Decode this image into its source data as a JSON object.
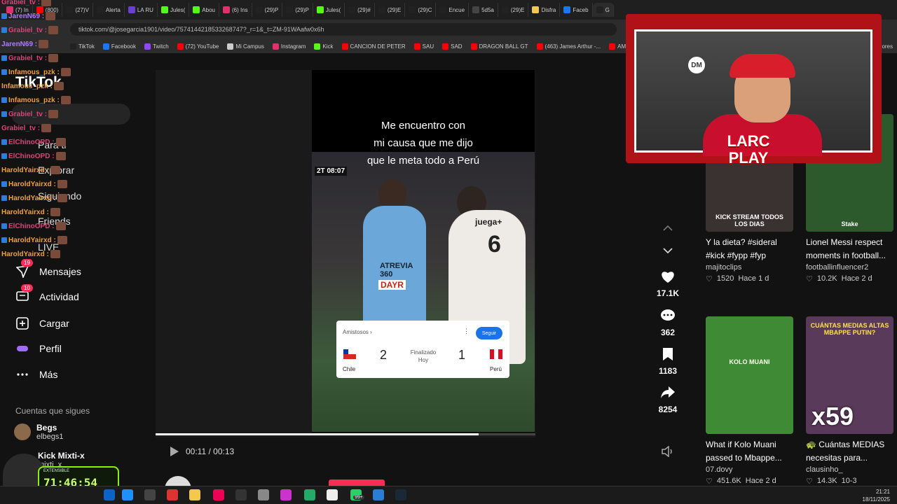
{
  "browser": {
    "tabs": [
      {
        "label": "(7) In",
        "color": "#e1306c"
      },
      {
        "label": "(800)",
        "color": "#ff0000"
      },
      {
        "label": "(27)V",
        "color": "#222222"
      },
      {
        "label": "Alerta",
        "color": "#222222"
      },
      {
        "label": "LA RU",
        "color": "#6a3fd4"
      },
      {
        "label": "Jules(",
        "color": "#53fc18"
      },
      {
        "label": "Abou",
        "color": "#53fc18"
      },
      {
        "label": "(6) Ins",
        "color": "#e1306c"
      },
      {
        "label": "(29)P",
        "color": "#222222"
      },
      {
        "label": "(29)P",
        "color": "#222222"
      },
      {
        "label": "Jules(",
        "color": "#53fc18"
      },
      {
        "label": "(29)#",
        "color": "#222222"
      },
      {
        "label": "(29)E",
        "color": "#222222"
      },
      {
        "label": "(29)C",
        "color": "#222222"
      },
      {
        "label": "Encue",
        "color": "#222222"
      },
      {
        "label": "5d5a",
        "color": "#444444"
      },
      {
        "label": "(29)E",
        "color": "#222222"
      },
      {
        "label": "Disfra",
        "color": "#f2c94c"
      },
      {
        "label": "Faceb",
        "color": "#1877f2"
      },
      {
        "label": "G",
        "color": "#222222"
      }
    ],
    "url": "tiktok.com/@josegarcia1901/video/7574144218533268747?_r=1&_t=ZM-91WAafw0x6h",
    "bookmarks": [
      {
        "label": "TikTok",
        "color": "#222222"
      },
      {
        "label": "Facebook",
        "color": "#1877f2"
      },
      {
        "label": "Twitch",
        "color": "#9146ff"
      },
      {
        "label": "(72) YouTube",
        "color": "#ff0000"
      },
      {
        "label": "Mi Campus",
        "color": "#cccccc"
      },
      {
        "label": "Instagram",
        "color": "#e1306c"
      },
      {
        "label": "Kick",
        "color": "#53fc18"
      },
      {
        "label": "CANCION DE PETER",
        "color": "#ff0000"
      },
      {
        "label": "SAU",
        "color": "#ff0000"
      },
      {
        "label": "SAD",
        "color": "#ff0000"
      },
      {
        "label": "DRAGON BALL GT",
        "color": "#ff0000"
      },
      {
        "label": "(463) James Arthur -...",
        "color": "#ff0000"
      },
      {
        "label": "AMOR",
        "color": "#ff0000"
      }
    ],
    "bookmarks_more": "ores"
  },
  "sidebar": {
    "logo": "TikTok",
    "nav": [
      {
        "label": "Mensajes",
        "icon": "message-icon",
        "badge": "19"
      },
      {
        "label": "Actividad",
        "icon": "activity-icon",
        "badge": "10"
      },
      {
        "label": "Cargar",
        "icon": "upload-icon",
        "badge": ""
      },
      {
        "label": "Perfil",
        "icon": "profile-icon",
        "badge": ""
      },
      {
        "label": "Más",
        "icon": "more-icon",
        "badge": ""
      }
    ],
    "following_title": "Cuentas que sigues",
    "following": [
      {
        "name": "Begs",
        "handle": "elbegs1"
      },
      {
        "name": "Kick Mixti-x",
        "handle": "mixti_x"
      }
    ]
  },
  "chat": [
    {
      "user": "Grabiel_tv :",
      "color": "#e0407a"
    },
    {
      "user": "JarenN69 :",
      "color": "#b07cff"
    },
    {
      "user": "Grabiel_tv :",
      "color": "#e0407a"
    },
    {
      "user": "JarenN69 :",
      "color": "#b07cff"
    },
    {
      "user": "Grabiel_tv :",
      "color": "#e0407a"
    },
    {
      "user": "Infamous_pzk :",
      "color": "#f0a030"
    },
    {
      "user": "Infamous_pzk :",
      "color": "#f0a030"
    },
    {
      "user": "Infamous_pzk :",
      "color": "#f0a030"
    },
    {
      "user": "Grabiel_tv :",
      "color": "#e0407a"
    },
    {
      "user": "Grabiel_tv :",
      "color": "#e0407a"
    },
    {
      "user": "ElChinoOPD :",
      "color": "#e0407a"
    },
    {
      "user": "ElChinoOPD :",
      "color": "#e0407a"
    },
    {
      "user": "HaroldYairxd :",
      "color": "#f0a030"
    },
    {
      "user": "HaroldYairxd :",
      "color": "#f0a030"
    },
    {
      "user": "HaroldYairxd :",
      "color": "#f0a030"
    },
    {
      "user": "HaroldYairxd :",
      "color": "#f0a030"
    },
    {
      "user": "ElChinoOPD :",
      "color": "#e0407a"
    },
    {
      "user": "HaroldYairxd :",
      "color": "#f0a030"
    },
    {
      "user": "HaroldYairxd :",
      "color": "#f0a030"
    }
  ],
  "sidebar_hidden": [
    "Para ti",
    "Explorar",
    "Siguiendo",
    "Friends",
    "LIVE"
  ],
  "video": {
    "caption_lines": [
      "Me encuentro con",
      "mi causa que me dijo",
      "que le meta todo a Perú"
    ],
    "timebug": "2T 08:07",
    "player1_sponsor": "ATREVIA 360",
    "player1_sponsor2": "DAYR",
    "player2_text": "juega+",
    "player2_number": "6",
    "scorecard": {
      "competition": "Amistosos ›",
      "follow_label": "Seguir",
      "team1": "Chile",
      "team2": "Perú",
      "score1": "2",
      "score2": "1",
      "status_line1": "Finalizado",
      "status_line2": "Hoy"
    },
    "time": "00:11 / 00:13",
    "progress": 0.85,
    "author": "josegarcia1901"
  },
  "actions": {
    "likes": "17.1K",
    "comments": "362",
    "saves": "1183",
    "shares": "8254"
  },
  "recommended": [
    {
      "title": "Y la dieta? #sideral #kick #fypp #fyp",
      "user": "majitoclips",
      "likes": "1520",
      "age": "Hace 1 d",
      "overlay": "KICK STREAM TODOS LOS DIAS",
      "thumb": "#3a3230"
    },
    {
      "title": "Lionel Messi respect moments in football...",
      "user": "footballinfluencer2",
      "likes": "10.2K",
      "age": "Hace 2 d",
      "overlay": "Stake",
      "thumb": "#2c5a2c"
    },
    {
      "title": "What if Kolo Muani passed to Mbappe...",
      "user": "07.dovy",
      "likes": "451.6K",
      "age": "Hace 2 d",
      "overlay": "KOLO MUANI",
      "thumb": "#3f8a35"
    },
    {
      "title": "🐢 Cuántas MEDIAS necesitas para...",
      "user": "clausinho_",
      "likes": "14.3K",
      "age": "10-3",
      "overlay": "CUÁNTAS MEDIAS ALTAS MBAPPE PUTIN?",
      "overlay2": "x59",
      "thumb": "#5a3a5a"
    }
  ],
  "webcam": {
    "overlay": "LARC PLAY"
  },
  "timer": {
    "label": "EXTENSIBLE",
    "value": "71:46:54"
  },
  "taskbar": {
    "badge": "99+",
    "time": "21:21",
    "date": "18/11/2025"
  }
}
